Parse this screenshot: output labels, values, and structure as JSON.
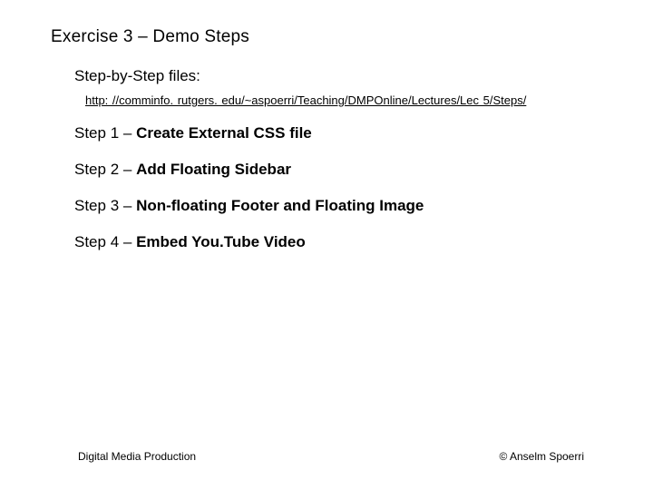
{
  "title": "Exercise 3 – Demo Steps",
  "subtitle": "Step-by-Step files:",
  "link": "http: //comminfo. rutgers. edu/~aspoerri/Teaching/DMPOnline/Lectures/Lec 5/Steps/",
  "steps": [
    {
      "label": "Step 1",
      "dash": " – ",
      "topic": "Create External CSS file"
    },
    {
      "label": "Step 2",
      "dash": " – ",
      "topic": "Add Floating Sidebar"
    },
    {
      "label": "Step 3",
      "dash": " – ",
      "topic": "Non-floating Footer and Floating Image"
    },
    {
      "label": "Step 4",
      "dash": " – ",
      "topic": "Embed You.Tube Video"
    }
  ],
  "footer": {
    "left": "Digital Media Production",
    "right": "© Anselm Spoerri"
  }
}
